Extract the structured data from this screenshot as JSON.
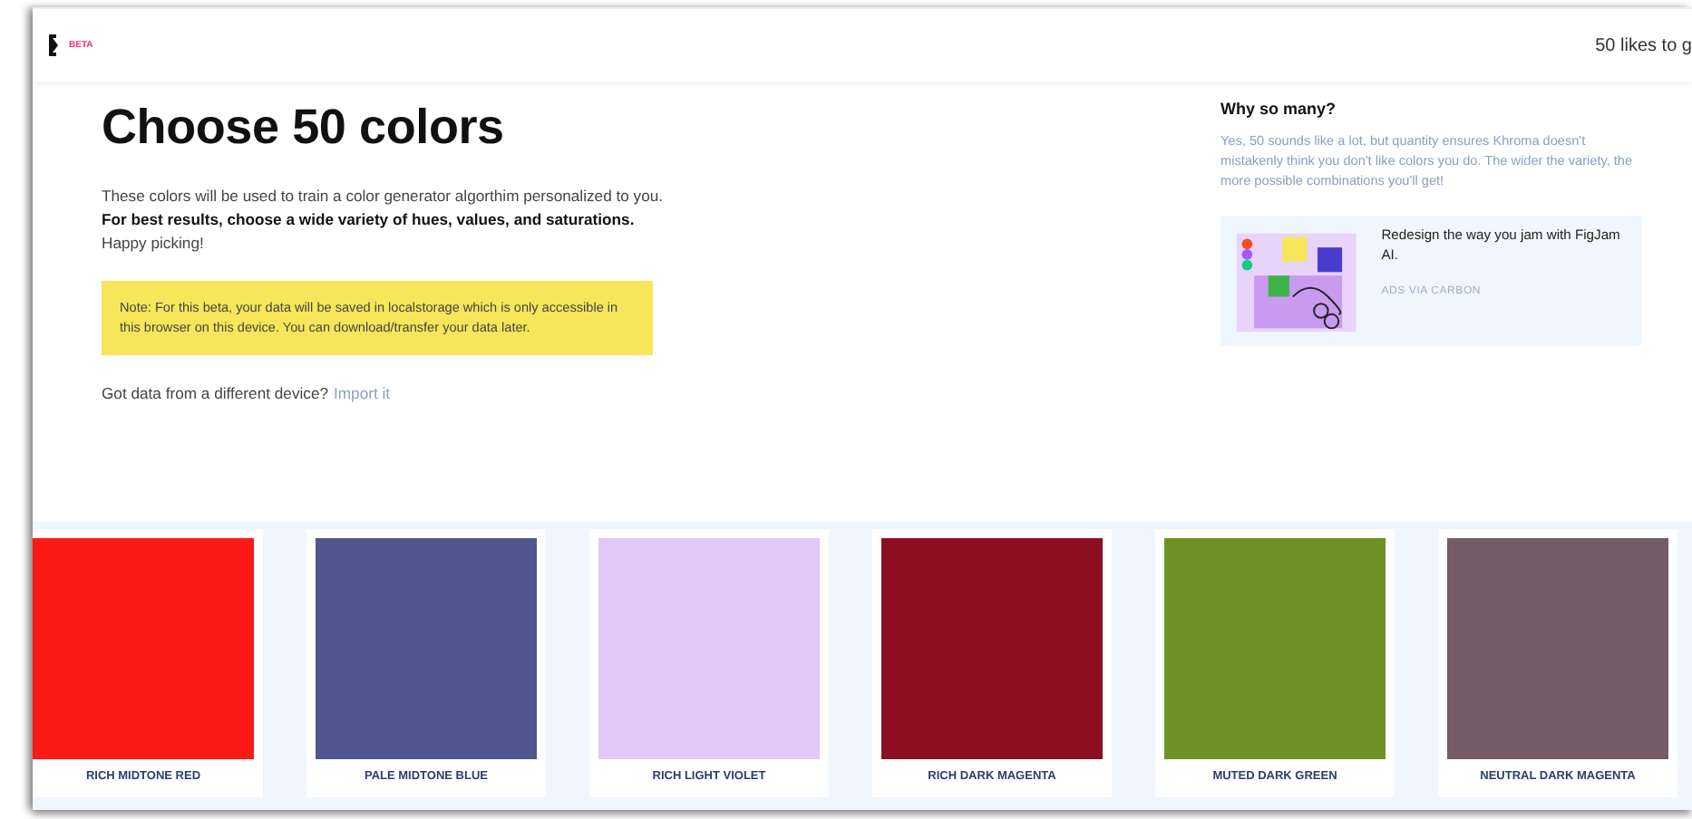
{
  "header": {
    "badge": "BETA",
    "likes_counter": "50 likes to g"
  },
  "intro": {
    "title": "Choose 50 colors",
    "description": "These colors will be used to train a color generator algorthim personalized to you. **For best results, choose a wide variety of hues, values, and saturations.** Happy picking!",
    "note": "Note: For this beta, your data will be saved in localstorage which is only accessible in this browser on this device. You can download/transfer your data later.",
    "import_prompt": "Got data from a different device?",
    "import_link": "Import it"
  },
  "sidebar": {
    "heading": "Why so many?",
    "text": "Yes, 50 sounds like a lot, but quantity ensures Khroma doesn't mistakenly think you don't like colors you do. The wider the variety, the more possible combinations you'll get!",
    "ad": {
      "text": "Redesign the way you jam with FigJam AI.",
      "credit": "ADS VIA CARBON"
    }
  },
  "swatches": [
    {
      "name": "RICH MIDTONE RED",
      "color": "#fb1b15"
    },
    {
      "name": "PALE MIDTONE BLUE",
      "color": "#51568f"
    },
    {
      "name": "RICH LIGHT VIOLET",
      "color": "#e2c8f9"
    },
    {
      "name": "RICH DARK MAGENTA",
      "color": "#8c1022"
    },
    {
      "name": "MUTED DARK GREEN",
      "color": "#709125"
    },
    {
      "name": "NEUTRAL DARK MAGENTA",
      "color": "#735c66"
    }
  ]
}
